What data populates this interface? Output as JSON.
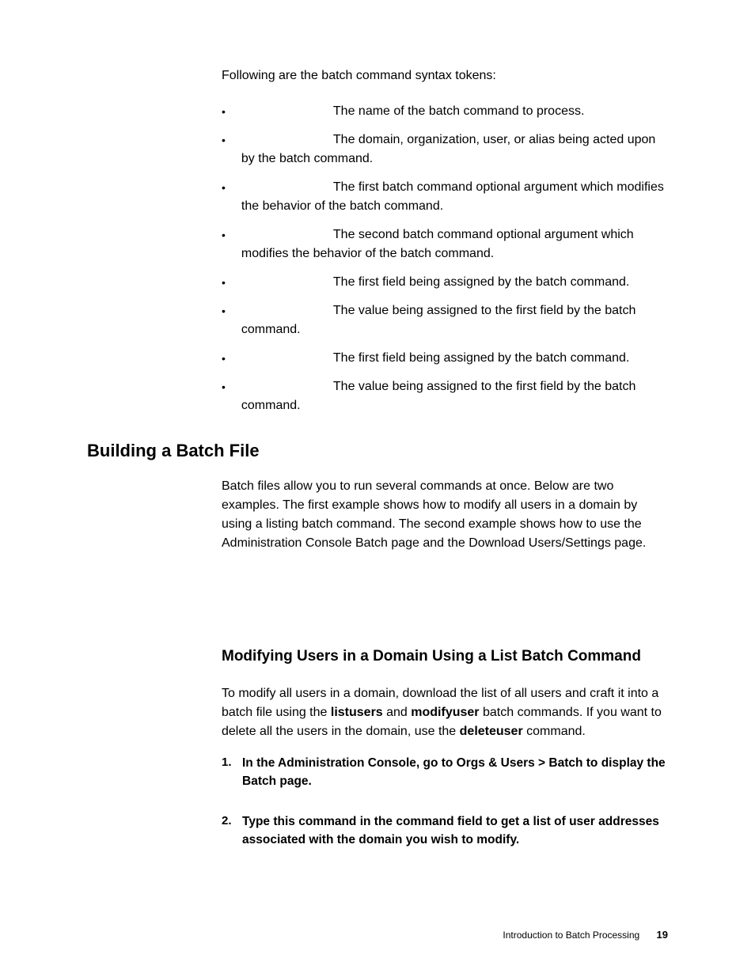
{
  "intro": "Following are the batch command syntax tokens:",
  "bullets": [
    {
      "desc": "The name of the batch command to process."
    },
    {
      "desc": "The domain, organization, user, or alias being acted upon by the batch command."
    },
    {
      "desc": "The first batch command optional argument which modifies the behavior of the batch command."
    },
    {
      "desc": "The second batch command optional argument which modifies the behavior of the batch command."
    },
    {
      "desc": "The first field being assigned by the batch command."
    },
    {
      "desc": "The value being assigned to the first field by the batch command."
    },
    {
      "desc": "The first field being assigned by the batch command."
    },
    {
      "desc": "The value being assigned to the first field by the batch command."
    }
  ],
  "h1": "Building a Batch File",
  "para1": "Batch files allow you to run several commands at once. Below are two examples. The first example shows how to modify all users in a domain by using a listing batch command. The second example shows how to use the Administration Console Batch page and the Download Users/Settings page.",
  "h2": "Modifying Users in a Domain Using a List Batch Command",
  "para2_pre": "To modify all users in a domain, download the list of all users and craft it into a batch file using the ",
  "para2_b1": "listusers",
  "para2_mid1": " and ",
  "para2_b2": "modifyuser",
  "para2_mid2": " batch commands. If you want to delete all the users in the domain, use the ",
  "para2_b3": "deleteuser",
  "para2_post": " command.",
  "steps": [
    {
      "n": "1.",
      "text": "In the Administration Console, go to Orgs & Users > Batch to display the Batch page."
    },
    {
      "n": "2.",
      "text": "Type this command in the command field to get a list of user addresses associated with the domain you wish to modify."
    }
  ],
  "footer_text": "Introduction to Batch Processing",
  "footer_page": "19"
}
